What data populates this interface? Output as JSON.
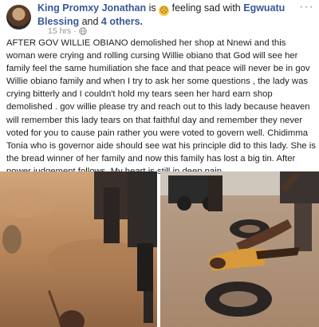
{
  "post": {
    "author_name": "King Promxy Jonathan",
    "feeling_prefix": " is ",
    "feeling_emoji": "sad-face-emoji",
    "feeling_text": " feeling sad with ",
    "tagged_person": "Egwuatu Blessing",
    "and_text": " and ",
    "others_link": "4 others.",
    "timestamp": "15 hrs",
    "separator": "·",
    "audience_icon": "globe-icon",
    "more_icon": "more-options-icon",
    "body": "AFTER GOV WILLIE OBIANO demolished her shop at Nnewi and this woman were crying and rolling cursing Willie obiano that God will see her family feel the same humiliation she face and that peace will never be in gov Willie obiano family and when I try to ask her some questions , the lady was crying bitterly and I couldn't hold my tears seen her hard earn shop demolished . gov willie please try and reach out to this lady because heaven will remember this lady tears on that faithful day and remember they never voted for you to cause pain rather you were voted to govern well. Chidimma Tonia who is governor aide should see wat his principle did to this lady. She is the bread winner of her family and now this family has lost a big tin. After power judgement follows. My heart is still in deep pain ."
  },
  "photos": [
    {
      "name": "left-photo",
      "subject": "woman crying on dusty ground"
    },
    {
      "name": "right-photo",
      "subject": "woman lying beside tyres on dirt road"
    }
  ]
}
